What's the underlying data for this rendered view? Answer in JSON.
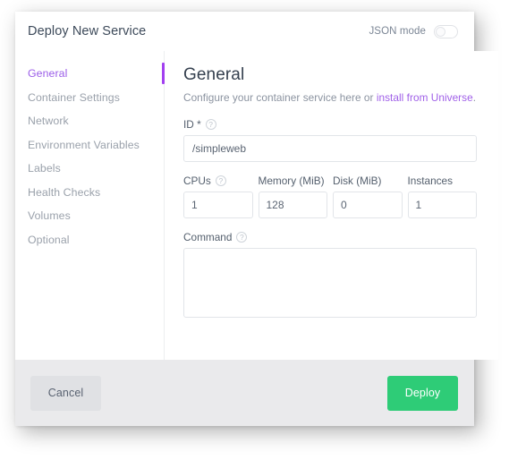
{
  "dialog": {
    "title": "Deploy New Service",
    "json_mode": {
      "label": "JSON mode",
      "enabled": false
    }
  },
  "sidebar": {
    "items": [
      {
        "label": "General",
        "active": true
      },
      {
        "label": "Container Settings",
        "active": false
      },
      {
        "label": "Network",
        "active": false
      },
      {
        "label": "Environment Variables",
        "active": false
      },
      {
        "label": "Labels",
        "active": false
      },
      {
        "label": "Health Checks",
        "active": false
      },
      {
        "label": "Volumes",
        "active": false
      },
      {
        "label": "Optional",
        "active": false
      }
    ]
  },
  "content": {
    "heading": "General",
    "description_prefix": "Configure your container service here or ",
    "description_link": "install from Universe",
    "description_suffix": ".",
    "fields": {
      "id": {
        "label": "ID *",
        "value": "/simpleweb",
        "placeholder": "",
        "help": "?"
      },
      "cpus": {
        "label": "CPUs",
        "value": "1",
        "help": "?"
      },
      "memory": {
        "label": "Memory (MiB)",
        "value": "128"
      },
      "disk": {
        "label": "Disk (MiB)",
        "value": "0"
      },
      "instances": {
        "label": "Instances",
        "value": "1"
      },
      "command": {
        "label": "Command",
        "value": "",
        "placeholder": "",
        "help": "?"
      }
    }
  },
  "footer": {
    "cancel_label": "Cancel",
    "deploy_label": "Deploy"
  },
  "colors": {
    "accent_purple": "#a23ff0",
    "link_purple": "#a060e8",
    "deploy_green": "#2ecc77",
    "footer_gray": "#eaeaec"
  }
}
